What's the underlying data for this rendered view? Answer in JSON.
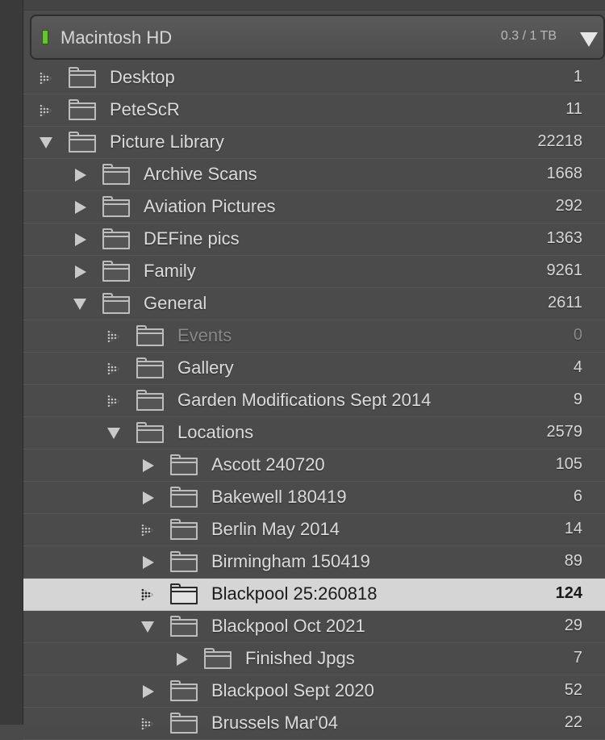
{
  "volume": {
    "name": "Macintosh HD",
    "usage": "0.3 / 1 TB",
    "status_color": "#67c431",
    "menu_icon": "triangle-down-icon"
  },
  "folders": [
    {
      "name": "Desktop",
      "count": "1",
      "level": 0,
      "toggle": "dotted"
    },
    {
      "name": "PeteScR",
      "count": "11",
      "level": 0,
      "toggle": "dotted"
    },
    {
      "name": "Picture Library",
      "count": "22218",
      "level": 0,
      "toggle": "expanded"
    },
    {
      "name": "Archive Scans",
      "count": "1668",
      "level": 1,
      "toggle": "collapsed"
    },
    {
      "name": "Aviation Pictures",
      "count": "292",
      "level": 1,
      "toggle": "collapsed"
    },
    {
      "name": "DEFine pics",
      "count": "1363",
      "level": 1,
      "toggle": "collapsed"
    },
    {
      "name": "Family",
      "count": "9261",
      "level": 1,
      "toggle": "collapsed"
    },
    {
      "name": "General",
      "count": "2611",
      "level": 1,
      "toggle": "expanded"
    },
    {
      "name": "Events",
      "count": "0",
      "level": 2,
      "toggle": "dotted",
      "dim": true
    },
    {
      "name": "Gallery",
      "count": "4",
      "level": 2,
      "toggle": "dotted"
    },
    {
      "name": "Garden Modifications Sept 2014",
      "count": "9",
      "level": 2,
      "toggle": "dotted"
    },
    {
      "name": "Locations",
      "count": "2579",
      "level": 2,
      "toggle": "expanded"
    },
    {
      "name": "Ascott 240720",
      "count": "105",
      "level": 3,
      "toggle": "collapsed"
    },
    {
      "name": "Bakewell 180419",
      "count": "6",
      "level": 3,
      "toggle": "collapsed"
    },
    {
      "name": "Berlin May 2014",
      "count": "14",
      "level": 3,
      "toggle": "dotted"
    },
    {
      "name": "Birmingham 150419",
      "count": "89",
      "level": 3,
      "toggle": "collapsed"
    },
    {
      "name": "Blackpool 25:260818",
      "count": "124",
      "level": 3,
      "toggle": "dotted",
      "selected": true
    },
    {
      "name": "Blackpool Oct 2021",
      "count": "29",
      "level": 3,
      "toggle": "expanded"
    },
    {
      "name": "Finished Jpgs",
      "count": "7",
      "level": 4,
      "toggle": "collapsed"
    },
    {
      "name": "Blackpool Sept 2020",
      "count": "52",
      "level": 3,
      "toggle": "collapsed"
    },
    {
      "name": "Brussels Mar'04",
      "count": "22",
      "level": 3,
      "toggle": "dotted"
    }
  ],
  "colors": {
    "panel_bg": "#4b4b4b",
    "selected_row_bg": "#d5d5d5",
    "text": "#dcdcdc"
  }
}
